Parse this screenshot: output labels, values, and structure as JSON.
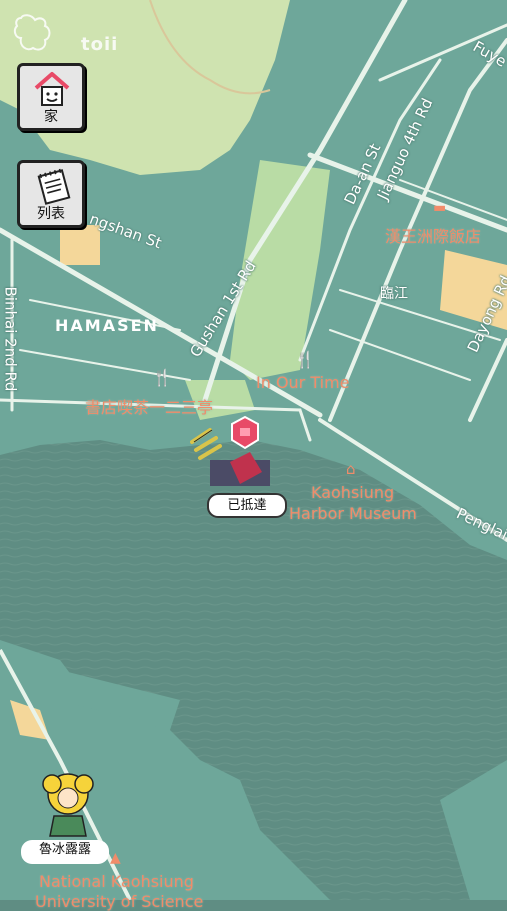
{
  "app": {
    "logo_text": "toii"
  },
  "buttons": {
    "home_label": "家",
    "list_label": "列表"
  },
  "map": {
    "streets": {
      "fuye": "Fuye",
      "gushan_st": "ngshan St",
      "binhai": "Binhai 2nd Rd",
      "gushan_1st": "Gushan 1st Rd",
      "daan": "Da-an St",
      "jianguo": "Jianguo 4th Rd",
      "dayong": "Dayong Rd",
      "penglai": "Penglai",
      "local_road": "臨江"
    },
    "district": "HAMASEN",
    "pois": {
      "hotel": "漢王洲際飯店",
      "in_our_time": "In Our Time",
      "bookstore_tea": "書店喫茶一二三亭",
      "museum_line1": "Kaohsiung",
      "museum_line2": "Harbor Museum",
      "university_line1": "National Kaohsiung",
      "university_line2": "University of Science"
    }
  },
  "markers": {
    "reached_label": "已抵達",
    "character_label": "魯冰露露"
  },
  "colors": {
    "land": "#6ea79a",
    "water": "#5f8d83",
    "park": "#cfe3b0",
    "road": "#e8f3ea",
    "accent_marker": "#e84a67"
  }
}
